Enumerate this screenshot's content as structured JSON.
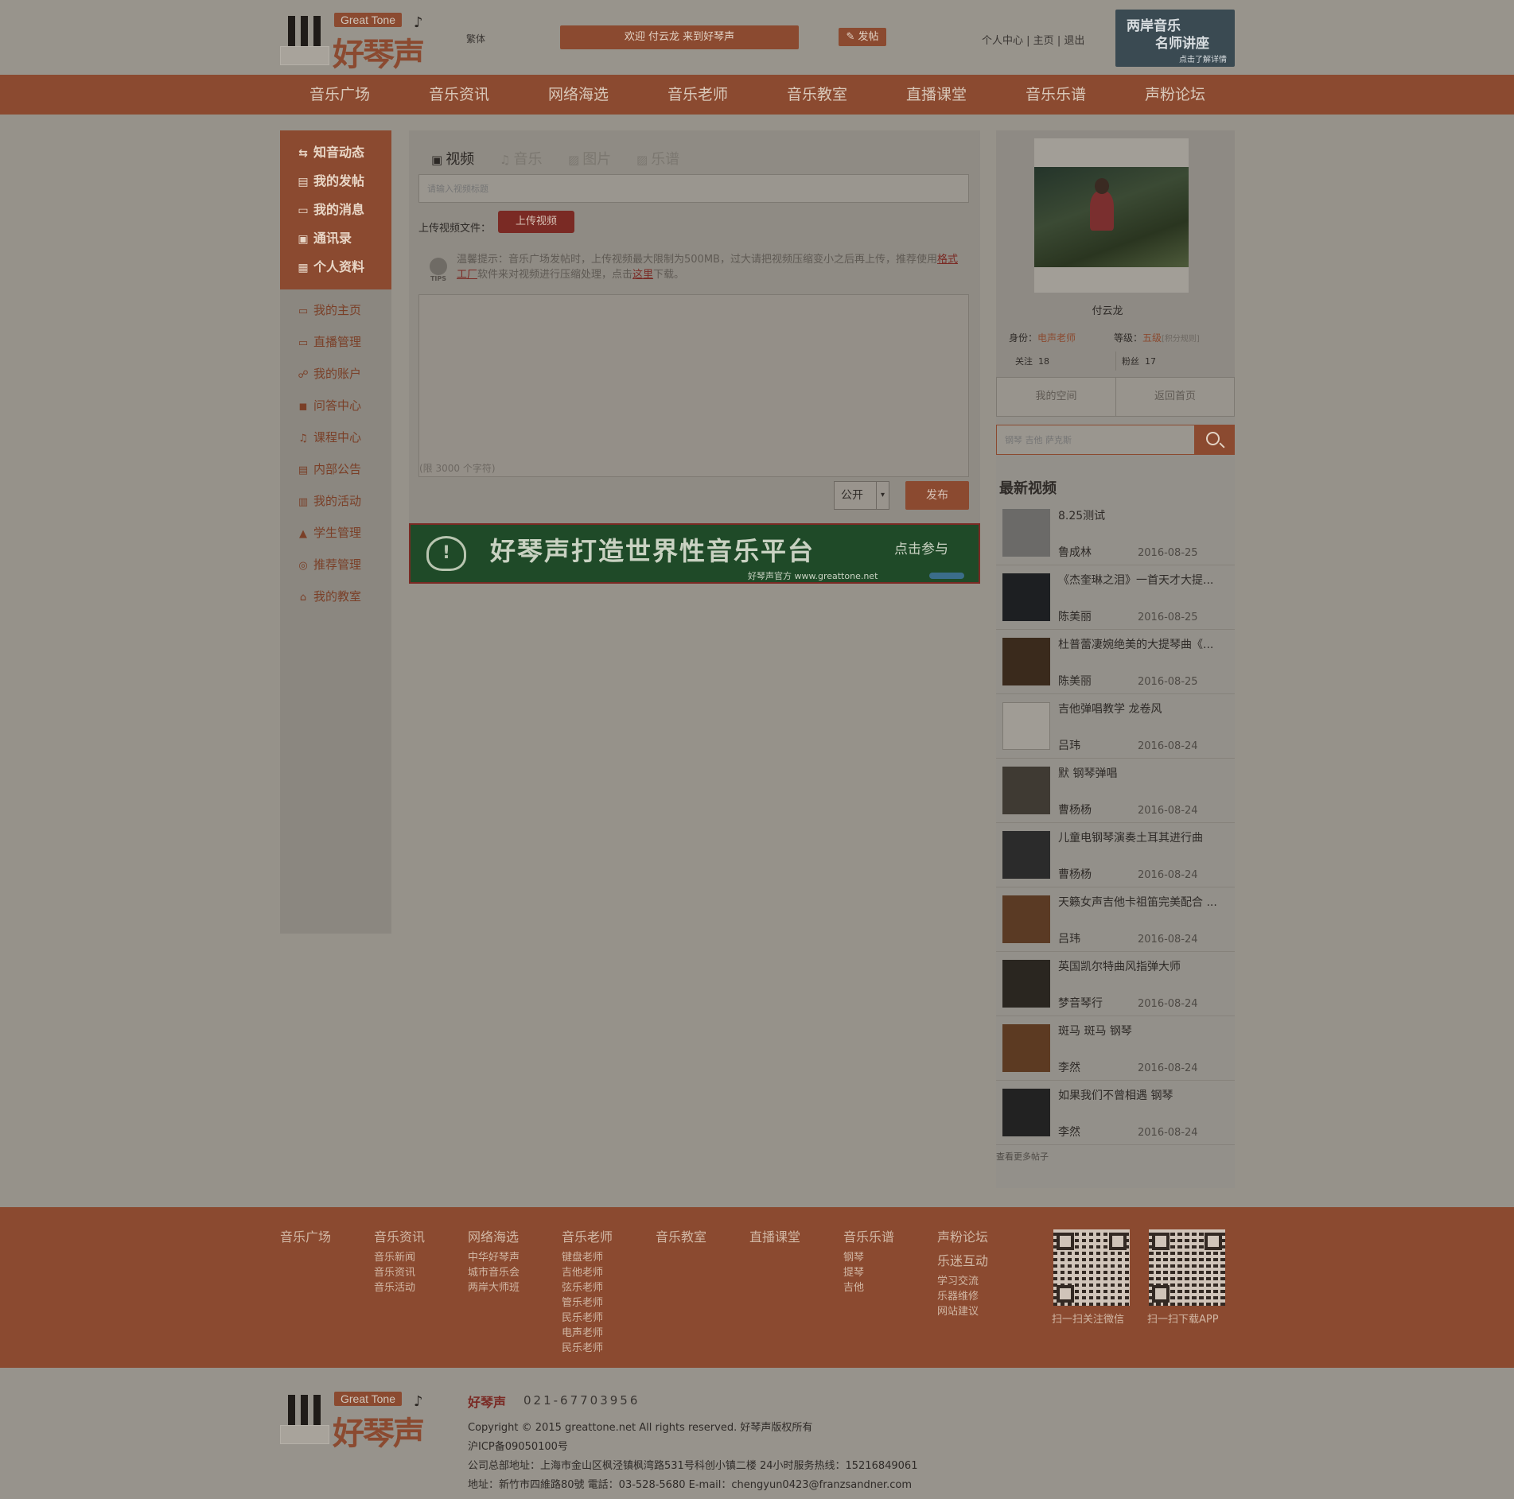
{
  "header": {
    "logo_en": "Great Tone",
    "logo_cn": "好琴声",
    "traditional_link": "繁体",
    "welcome": "欢迎 付云龙 来到好琴声",
    "post_button": "发帖",
    "user_links": [
      "个人中心",
      "主页",
      "退出"
    ],
    "banner_line1": "两岸音乐",
    "banner_line2": "名师讲座",
    "banner_line3": "点击了解详情"
  },
  "nav": [
    "音乐广场",
    "音乐资讯",
    "网络海选",
    "音乐老师",
    "音乐教室",
    "直播课堂",
    "音乐乐谱",
    "声粉论坛"
  ],
  "sidebar": {
    "top_items": [
      {
        "label": "知音动态",
        "icon": "share-icon"
      },
      {
        "label": "我的发帖",
        "icon": "document-icon"
      },
      {
        "label": "我的消息",
        "icon": "message-icon"
      },
      {
        "label": "通讯录",
        "icon": "contacts-icon"
      },
      {
        "label": "个人资料",
        "icon": "profile-card-icon"
      }
    ],
    "items": [
      {
        "label": "我的主页",
        "icon": "monitor-icon"
      },
      {
        "label": "直播管理",
        "icon": "monitor-icon"
      },
      {
        "label": "我的账户",
        "icon": "users-icon"
      },
      {
        "label": "问答中心",
        "icon": "chat-icon"
      },
      {
        "label": "课程中心",
        "icon": "music-note-icon"
      },
      {
        "label": "内部公告",
        "icon": "notice-icon"
      },
      {
        "label": "我的活动",
        "icon": "gift-icon"
      },
      {
        "label": "学生管理",
        "icon": "graduation-cap-icon"
      },
      {
        "label": "推荐管理",
        "icon": "recommend-icon"
      },
      {
        "label": "我的教室",
        "icon": "home-icon"
      }
    ]
  },
  "main": {
    "tabs": [
      {
        "label": "视频",
        "icon": "film-icon"
      },
      {
        "label": "音乐",
        "icon": "music-note-icon"
      },
      {
        "label": "图片",
        "icon": "image-icon"
      },
      {
        "label": "乐谱",
        "icon": "image-icon"
      }
    ],
    "title_placeholder": "请输入视频标题",
    "upload_label": "上传视频文件：",
    "upload_button": "上传视频",
    "tip_prefix": "温馨提示：音乐广场发帖时，上传视频最大限制为500MB，过大请把视频压缩变小之后再上传，推荐使用",
    "tip_link1": "格式工厂",
    "tip_middle": "软件来对视频进行压缩处理，点击",
    "tip_link2": "这里",
    "tip_suffix": "下载。",
    "tips_badge": "TIPS",
    "textarea_placeholder": "(限 3000 个字符)",
    "visibility": "公开",
    "publish_button": "发布",
    "ad_text": "好琴声打造世界性音乐平台",
    "ad_cta": "点击参与",
    "ad_sub": "好琴声官方 www.greattone.net"
  },
  "profile": {
    "name": "付云龙",
    "identity_label": "身份：",
    "identity_value": "电声老师",
    "level_label": "等级：",
    "level_value": "五级",
    "level_rules": "[积分规则]",
    "follow_label": "关注",
    "follow_count": "18",
    "fans_label": "粉丝",
    "fans_count": "17",
    "my_space": "我的空间",
    "back_home": "返回首页"
  },
  "search": {
    "placeholder": "钢琴 吉他 萨克斯"
  },
  "latest": {
    "title": "最新视频",
    "more": "查看更多帖子",
    "items": [
      {
        "title": "8.25测试",
        "author": "鲁成林",
        "date": "2016-08-25",
        "color": "#6b6a68"
      },
      {
        "title": "《杰奎琳之泪》一首天才大提...",
        "author": "陈美丽",
        "date": "2016-08-25",
        "color": "#1d1f22"
      },
      {
        "title": "杜普蕾凄婉绝美的大提琴曲《...",
        "author": "陈美丽",
        "date": "2016-08-25",
        "color": "#3a2a1c"
      },
      {
        "title": "吉他弹唱教学 龙卷风",
        "author": "吕玮",
        "date": "2016-08-24",
        "color": "#a09c95"
      },
      {
        "title": "默 钢琴弹唱",
        "author": "曹杨杨",
        "date": "2016-08-24",
        "color": "#3f3a33"
      },
      {
        "title": "儿童电钢琴演奏土耳其进行曲",
        "author": "曹杨杨",
        "date": "2016-08-24",
        "color": "#2b2b2b"
      },
      {
        "title": "天籁女声吉他卡祖笛完美配合 ...",
        "author": "吕玮",
        "date": "2016-08-24",
        "color": "#5a3a24"
      },
      {
        "title": "英国凯尔特曲风指弹大师",
        "author": "梦音琴行",
        "date": "2016-08-24",
        "color": "#2a2620"
      },
      {
        "title": "斑马 斑马 钢琴",
        "author": "李然",
        "date": "2016-08-24",
        "color": "#5c3a22"
      },
      {
        "title": "如果我们不曾相遇 钢琴",
        "author": "李然",
        "date": "2016-08-24",
        "color": "#222222"
      }
    ]
  },
  "footer": {
    "columns": [
      {
        "title": "音乐广场",
        "links": []
      },
      {
        "title": "音乐资讯",
        "links": [
          "音乐新闻",
          "音乐资讯",
          "音乐活动"
        ]
      },
      {
        "title": "网络海选",
        "links": [
          "中华好琴声",
          "城市音乐会",
          "两岸大师班"
        ]
      },
      {
        "title": "音乐老师",
        "links": [
          "键盘老师",
          "吉他老师",
          "弦乐老师",
          "管乐老师",
          "民乐老师",
          "电声老师",
          "民乐老师"
        ]
      },
      {
        "title": "音乐教室",
        "links": []
      },
      {
        "title": "直播课堂",
        "links": []
      },
      {
        "title": "音乐乐谱",
        "links": [
          "钢琴",
          "提琴",
          "吉他"
        ]
      },
      {
        "title": "声粉论坛",
        "links": []
      }
    ],
    "extra_title": "乐迷互动",
    "extra_links": [
      "学习交流",
      "乐器维修",
      "网站建议"
    ],
    "qr_wechat": "扫一扫关注微信",
    "qr_app": "扫一扫下载APP"
  },
  "bottom": {
    "brand": "好琴声",
    "phone": "021-67703956",
    "copyright": "Copyright © 2015 greattone.net All rights reserved. 好琴声版权所有",
    "icp": "沪ICP备09050100号",
    "address1": "公司总部地址：上海市金山区枫泾镇枫湾路531号科创小镇二楼 24小时服务热线：15216849061",
    "address2": "地址：新竹市四維路80號 電話：03-528-5680 E-mail：chengyun0423@franzsandner.com"
  }
}
